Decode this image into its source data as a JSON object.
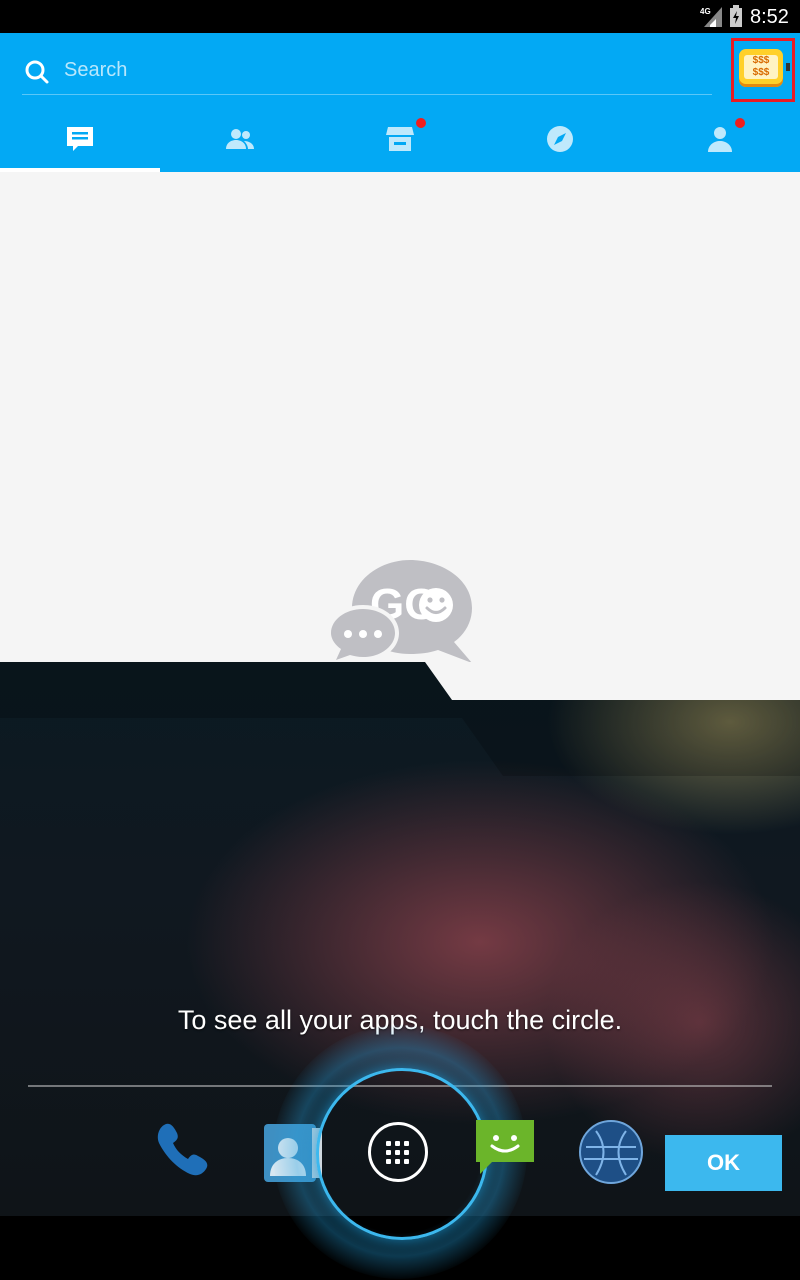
{
  "status_bar": {
    "network": "4G",
    "time": "8:52"
  },
  "search": {
    "placeholder": "Search"
  },
  "tabs": [
    {
      "icon": "chat-icon",
      "active": true,
      "badge": false
    },
    {
      "icon": "contacts-icon",
      "active": false,
      "badge": false
    },
    {
      "icon": "store-icon",
      "active": false,
      "badge": true
    },
    {
      "icon": "compass-icon",
      "active": false,
      "badge": true
    },
    {
      "icon": "profile-icon",
      "active": false,
      "badge": true
    }
  ],
  "logo": {
    "text": "GO"
  },
  "overlay": {
    "hint": "To see all your apps, touch the circle.",
    "ok_label": "OK"
  },
  "dock": [
    "phone-icon",
    "contacts-app-icon",
    "all-apps-icon",
    "messaging-icon",
    "browser-icon"
  ],
  "colors": {
    "accent": "#03a9f4",
    "badge": "#f01e1e",
    "ok_button": "#3cb8ee"
  }
}
